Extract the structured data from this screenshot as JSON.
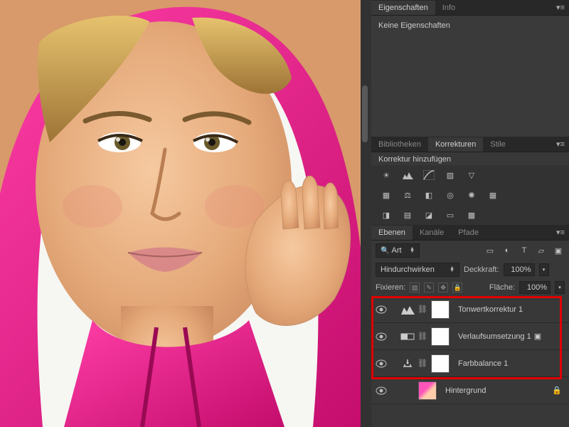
{
  "properties": {
    "tab1": "Eigenschaften",
    "tab2": "Info",
    "empty": "Keine Eigenschaften"
  },
  "libs": {
    "tab1": "Bibliotheken",
    "tab2": "Korrekturen",
    "tab3": "Stile",
    "addlabel": "Korrektur hinzufügen"
  },
  "layers": {
    "tab1": "Ebenen",
    "tab2": "Kanäle",
    "tab3": "Pfade",
    "filter": "Art",
    "blend": "Hindurchwirken",
    "opacity_label": "Deckkraft:",
    "opacity": "100%",
    "lock_label": "Fixieren:",
    "fill_label": "Fläche:",
    "fill": "100%",
    "items": [
      {
        "name": "Tonwertkorrektur 1",
        "icon": "levels"
      },
      {
        "name": "Verlaufsumsetzung 1",
        "icon": "gradmap"
      },
      {
        "name": "Farbbalance 1",
        "icon": "balance"
      },
      {
        "name": "Hintergrund",
        "icon": "bg"
      }
    ]
  }
}
